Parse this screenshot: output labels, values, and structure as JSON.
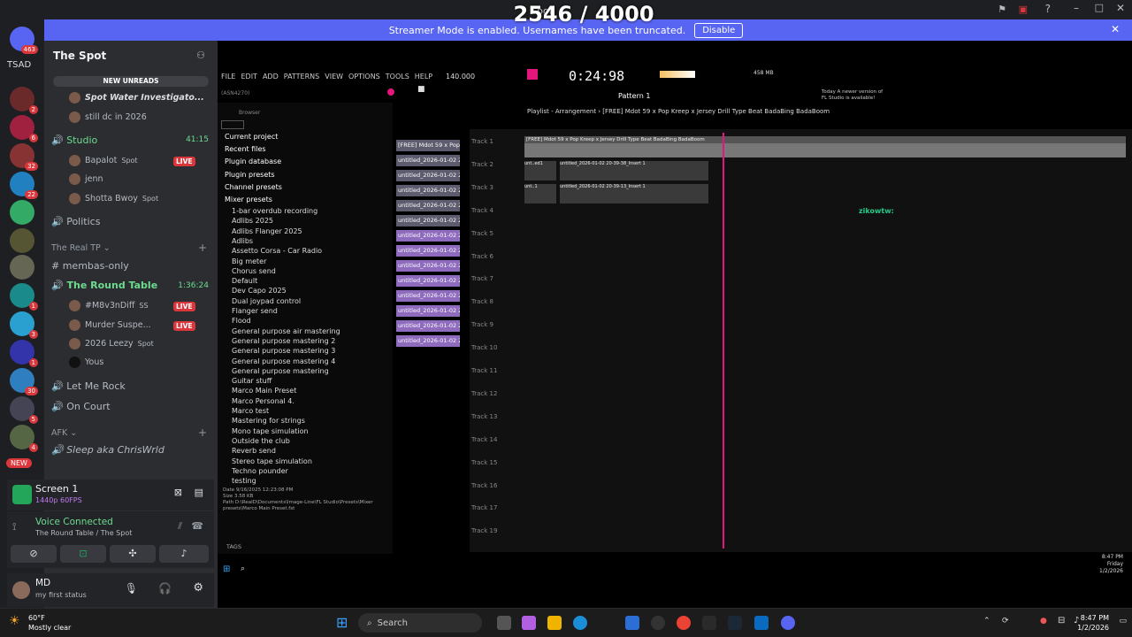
{
  "overlay": {
    "counter": "2546 / 4000",
    "window_title": "Spot"
  },
  "banner": {
    "text": "Streamer Mode is enabled. Usernames have been truncated.",
    "disable_label": "Disable"
  },
  "rail": {
    "dm_badge": "463",
    "folder_label": "TSAD",
    "badges": [
      "2",
      "6",
      "32",
      "22",
      "1",
      "3",
      "1",
      "30",
      "5",
      "4"
    ],
    "new_label": "NEW"
  },
  "server": {
    "name": "The Spot",
    "new_unreads": "NEW UNREADS"
  },
  "channels": {
    "unread1": "Spot Water Investigato...",
    "unread2": "still dc in 2026",
    "studio": {
      "name": "Studio",
      "timer": "41:15"
    },
    "studio_users": [
      {
        "name": "Bapalot",
        "tag": "Spot",
        "live": "LIVE"
      },
      {
        "name": "jenn"
      },
      {
        "name": "Shotta Bwoy",
        "tag": "Spot"
      }
    ],
    "politics": "Politics",
    "cat_realtp": "The Real TP",
    "membas": "membas-only",
    "roundtable": {
      "name": "The Round Table",
      "timer": "1:36:24"
    },
    "round_users": [
      {
        "name": "#M8v3nDiff",
        "tag": "SS",
        "live": "LIVE"
      },
      {
        "name": "Murder Suspe...",
        "live": "LIVE"
      },
      {
        "name": "2026 Leezy",
        "tag": "Spot"
      },
      {
        "name": "Yous"
      }
    ],
    "letmerock": "Let Me Rock",
    "oncourt": "On Court",
    "cat_afk": "AFK",
    "sleep": "Sleep aka ChrisWrld"
  },
  "screenshare": {
    "title": "Screen 1",
    "sub": "1440p 60FPS"
  },
  "voice": {
    "status": "Voice Connected",
    "location": "The Round Table / The Spot"
  },
  "user": {
    "name": "MD",
    "status": "my first status"
  },
  "fl": {
    "menu": [
      "FILE",
      "EDIT",
      "ADD",
      "PATTERNS",
      "VIEW",
      "OPTIONS",
      "TOOLS",
      "HELP"
    ],
    "tempo": "140.000",
    "time": "0:24:98",
    "memory": "458 MB",
    "pattern": "Pattern 1",
    "hint_line1": "Today  A newer version of",
    "hint_line2": "FL Studio is available!",
    "playlist_title": "Playlist - Arrangement  › [FREE] Mdot 59 x Pop Kreep x Jersey Drill Type Beat BadaBing BadaBoom",
    "browser_label": "Browser",
    "asn": "(ASN4270)",
    "browser_items": [
      "Current project",
      "Recent files",
      "Plugin database",
      "Plugin presets",
      "Channel presets",
      "Mixer presets"
    ],
    "mixer_presets": [
      "1-bar overdub recording",
      "Adlibs 2025",
      "Adlibs Flanger 2025",
      "Adlibs",
      "Assetto Corsa - Car Radio",
      "Big meter",
      "Chorus send",
      "Default",
      "Dev Capo 2025",
      "Dual joypad control",
      "Flanger send",
      "Flood",
      "General purpose air mastering",
      "General purpose mastering 2",
      "General purpose mastering 3",
      "General purpose mastering 4",
      "General purpose mastering",
      "Guitar stuff",
      "Marco Main Preset",
      "Marco Personal 4.",
      "Marco test",
      "Mastering for strings",
      "Mono tape simulation",
      "Outside the club",
      "Reverb send",
      "Stereo tape simulation",
      "Techno pounder",
      "testing"
    ],
    "file_info": {
      "date": "Date  9/16/2025 12:23:08 PM",
      "size": "Size  3.58 KB",
      "path": "Path  D:\\RealD\\Documents\\Image-Line\\FL Studio\\Presets\\Mixer presets\\Marco Main Preset.fst"
    },
    "tags_label": "TAGS",
    "channel_clips": [
      "[FREE] Mdot 59 x Pop...",
      "untitled_2026-01-02 20-",
      "untitled_2026-01-02 20-",
      "untitled_2026-01-02 20-",
      "untitled_2026-01-02 20-",
      "untitled_2026-01-02 20-",
      "untitled_2026-01-02 20-",
      "untitled_2026-01-02 20-",
      "untitled_2026-01-02 20-",
      "untitled_2026-01-02 20-",
      "untitled_2026-01-02 20-",
      "untitled_2026-01-02 20-",
      "untitled_2026-01-02 20-",
      "untitled_2026-01-02 20-"
    ],
    "tracks": [
      "Track 1",
      "Track 2",
      "Track 3",
      "Track 4",
      "Track 5",
      "Track 6",
      "Track 7",
      "Track 8",
      "Track 9",
      "Track 10",
      "Track 11",
      "Track 12",
      "Track 13",
      "Track 14",
      "Track 15",
      "Track 16",
      "Track 17",
      "Track 19"
    ],
    "clip_track1": "[FREE] Mdot 59 x Pop Kreep x Jersey Drill Type Beat BadaBing BadaBoom",
    "clip_track2a": "unt..ed1",
    "clip_track2b": "untitled_2026-01-02 20-39-38_Insert 1",
    "clip_track3a": "unt..1",
    "clip_track3b": "untitled_2026-01-02 20-39-13_Insert 1",
    "chat_user": "zikowtw:",
    "inner_clock": {
      "time": "8:47 PM",
      "day": "Friday",
      "date": "1/2/2026"
    }
  },
  "taskbar": {
    "weather_temp": "60°F",
    "weather_desc": "Mostly clear",
    "search": "Search",
    "time": "8:47 PM",
    "date": "1/2/2026"
  },
  "colors": {
    "discord_blurple": "#5865f2",
    "live_red": "#da373c",
    "green": "#23a55a",
    "fl_pink": "#e3177b"
  }
}
